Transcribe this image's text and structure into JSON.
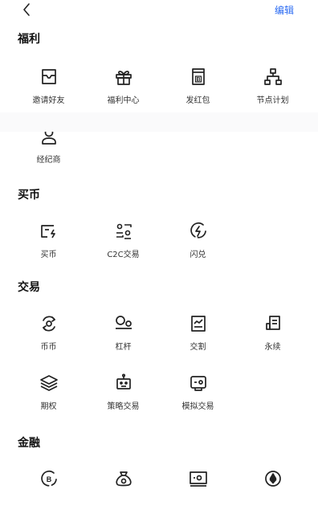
{
  "header": {
    "edit_label": "编辑"
  },
  "sections": [
    {
      "title": "福利",
      "items": [
        {
          "label": "邀请好友",
          "icon": "envelope-icon"
        },
        {
          "label": "福利中心",
          "icon": "gift-icon"
        },
        {
          "label": "发红包",
          "icon": "red-packet-icon"
        },
        {
          "label": "节点计划",
          "icon": "node-network-icon"
        },
        {
          "label": "经纪商",
          "icon": "user-icon"
        }
      ]
    },
    {
      "title": "买币",
      "items": [
        {
          "label": "买币",
          "icon": "buy-crypto-icon"
        },
        {
          "label": "C2C交易",
          "icon": "c2c-icon"
        },
        {
          "label": "闪兑",
          "icon": "flash-swap-icon"
        }
      ]
    },
    {
      "title": "交易",
      "items": [
        {
          "label": "币币",
          "icon": "spot-exchange-icon"
        },
        {
          "label": "杠杆",
          "icon": "margin-icon"
        },
        {
          "label": "交割",
          "icon": "delivery-chart-icon"
        },
        {
          "label": "永续",
          "icon": "perpetual-doc-icon"
        },
        {
          "label": "期权",
          "icon": "layers-icon"
        },
        {
          "label": "策略交易",
          "icon": "robot-icon"
        },
        {
          "label": "模拟交易",
          "icon": "demo-trade-icon"
        }
      ]
    },
    {
      "title": "金融",
      "items": [
        {
          "label": "",
          "icon": "bitcoin-coin-icon"
        },
        {
          "label": "",
          "icon": "money-bag-icon"
        },
        {
          "label": "",
          "icon": "cash-icon"
        },
        {
          "label": "",
          "icon": "ethereum-icon"
        }
      ]
    }
  ]
}
